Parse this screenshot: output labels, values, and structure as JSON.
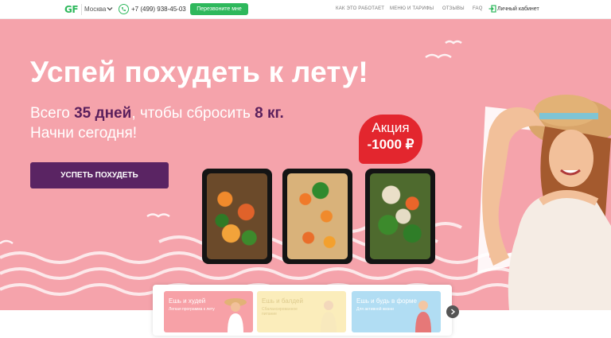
{
  "header": {
    "logo": "GF",
    "city": "Москва",
    "phone": "+7 (499) 938-45-03",
    "callback_label": "Перезвоните мне",
    "nav": [
      "КАК ЭТО РАБОТАЕТ",
      "МЕНЮ И ТАРИФЫ",
      "ОТЗЫВЫ",
      "FAQ"
    ],
    "login_label": "Личный кабинет"
  },
  "hero": {
    "title": "Успей похудеть к лету!",
    "sub_prefix": "Всего ",
    "sub_days": "35 дней",
    "sub_middle": ", чтобы сбросить ",
    "sub_kg": "8 кг.",
    "sub_line2": "Начни сегодня!",
    "cta_label": "Успеть похудеть",
    "promo_line1": "Акция",
    "promo_line2": "-1000 ₽"
  },
  "cards": [
    {
      "title": "Ешь и худей",
      "text": "Легкая программа к лету"
    },
    {
      "title": "Ешь и балдей",
      "text": "Сбалансированное питание"
    },
    {
      "title": "Ешь и будь в форме",
      "text": "Для активной жизни"
    }
  ],
  "colors": {
    "brand_green": "#2eb85c",
    "hero_pink": "#f5a3ab",
    "cta_purple": "#5a2463",
    "promo_red": "#e3262e"
  },
  "icons": [
    "chevron-down-icon",
    "phone-icon",
    "login-icon",
    "chevron-right-icon"
  ]
}
